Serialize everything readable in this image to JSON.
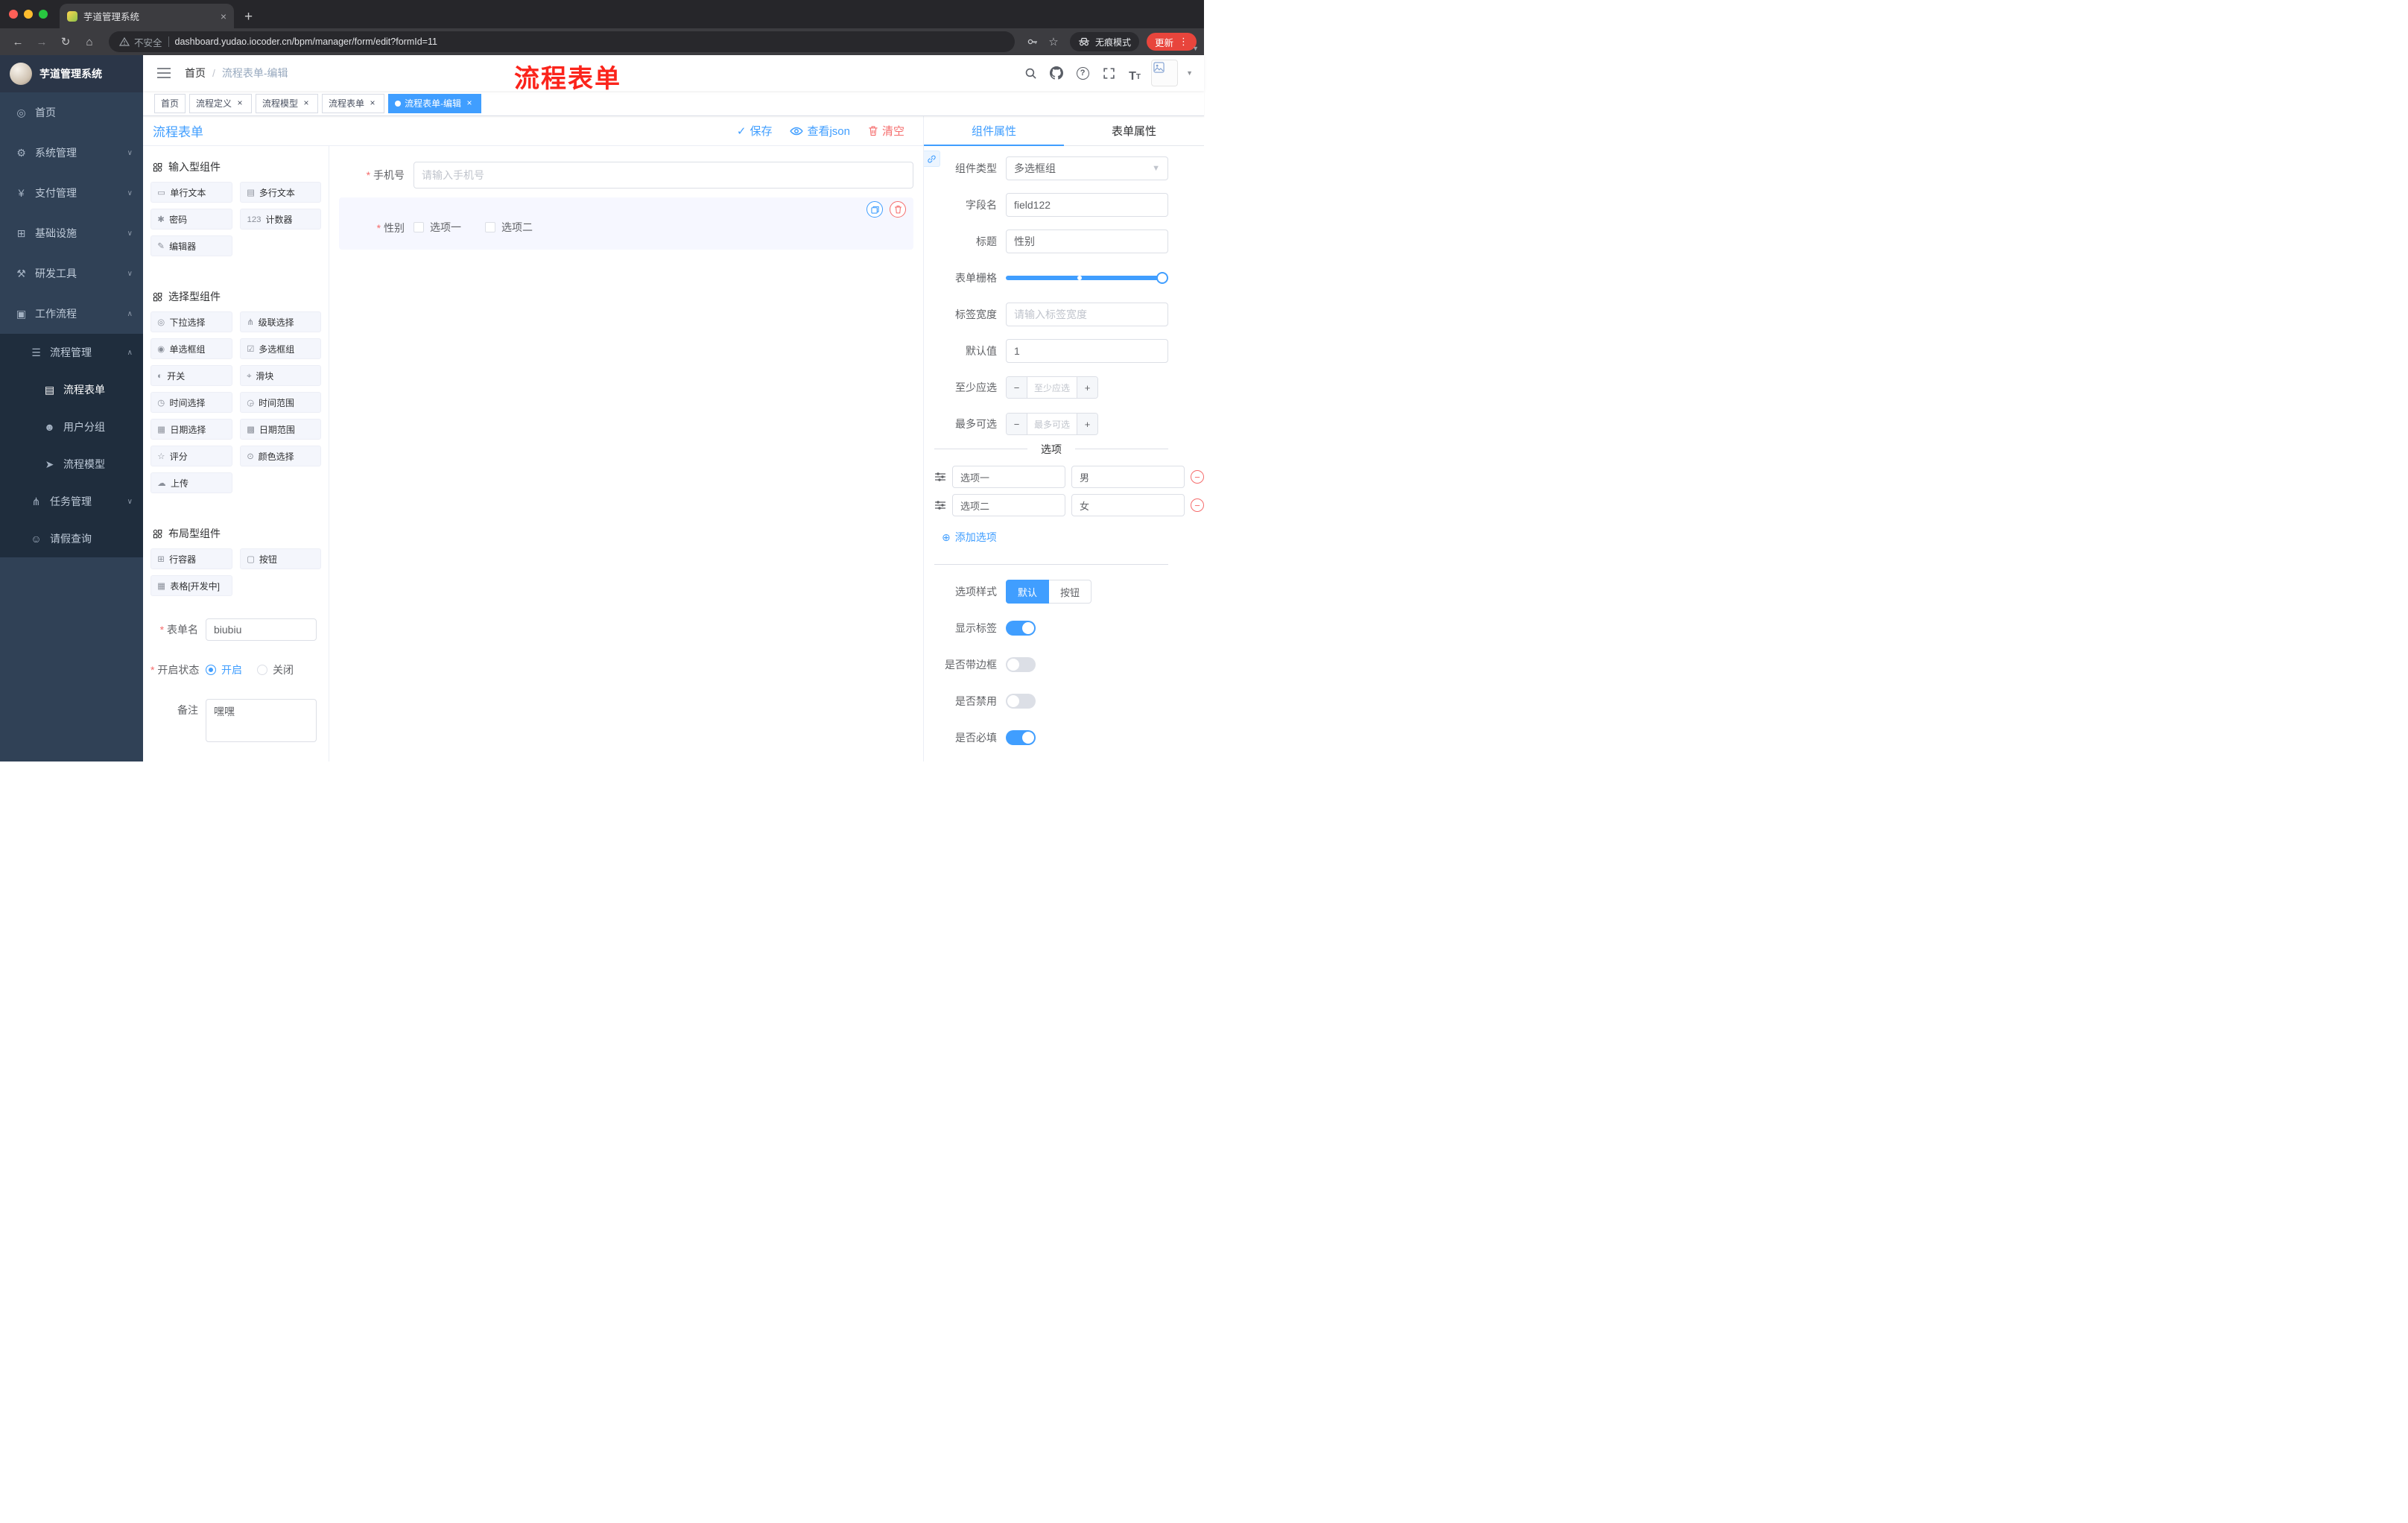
{
  "colors": {
    "accent": "#409eff",
    "danger": "#f56c6c",
    "sidebar_bg": "#304156",
    "submenu_bg": "#1f2d3d",
    "tag_active": "#409eff",
    "update_red": "#e8453c"
  },
  "browser": {
    "tab_title": "芋道管理系统",
    "security_label": "不安全",
    "url": "dashboard.yudao.iocoder.cn/bpm/manager/form/edit?formId=11",
    "incognito_label": "无痕模式",
    "update_label": "更新"
  },
  "annotation_title": "流程表单",
  "navbar": {
    "breadcrumb_home": "首页",
    "breadcrumb_sep": "/",
    "breadcrumb_current": "流程表单-编辑"
  },
  "tags": [
    {
      "label": "首页",
      "closable": false,
      "active": false
    },
    {
      "label": "流程定义",
      "closable": true,
      "active": false
    },
    {
      "label": "流程模型",
      "closable": true,
      "active": false
    },
    {
      "label": "流程表单",
      "closable": true,
      "active": false
    },
    {
      "label": "流程表单-编辑",
      "closable": true,
      "active": true
    }
  ],
  "sidebar": {
    "logo_title": "芋道管理系统",
    "menu": [
      {
        "id": "home",
        "label": "首页",
        "icon": "dashboard-icon",
        "glyph": "◎",
        "level": 1
      },
      {
        "id": "system-management",
        "label": "系统管理",
        "icon": "gear-icon",
        "glyph": "⚙",
        "level": 1,
        "chevron": "down"
      },
      {
        "id": "payment-management",
        "label": "支付管理",
        "icon": "yen-icon",
        "glyph": "¥",
        "level": 1,
        "chevron": "down"
      },
      {
        "id": "infrastructure",
        "label": "基础设施",
        "icon": "infrastructure-icon",
        "glyph": "⊞",
        "level": 1,
        "chevron": "down"
      },
      {
        "id": "dev-tools",
        "label": "研发工具",
        "icon": "tools-icon",
        "glyph": "⚒",
        "level": 1,
        "chevron": "down"
      },
      {
        "id": "workflow",
        "label": "工作流程",
        "icon": "workflow-icon",
        "glyph": "▣",
        "level": 1,
        "chevron": "up"
      },
      {
        "id": "process-management",
        "label": "流程管理",
        "icon": "process-list-icon",
        "glyph": "☰",
        "level": 2,
        "chevron": "up"
      },
      {
        "id": "process-form",
        "label": "流程表单",
        "icon": "form-document-icon",
        "glyph": "▤",
        "level": 3,
        "active": true
      },
      {
        "id": "user-group",
        "label": "用户分组",
        "icon": "user-group-icon",
        "glyph": "☻",
        "level": 3
      },
      {
        "id": "process-model",
        "label": "流程模型",
        "icon": "send-icon",
        "glyph": "➤",
        "level": 3
      },
      {
        "id": "task-management",
        "label": "任务管理",
        "icon": "task-tree-icon",
        "glyph": "⋔",
        "level": 2,
        "chevron": "down"
      },
      {
        "id": "leave-query",
        "label": "请假查询",
        "icon": "person-icon",
        "glyph": "☺",
        "level": 2
      }
    ]
  },
  "editor": {
    "title": "流程表单",
    "save_label": "保存",
    "view_json_label": "查看json",
    "clear_label": "清空",
    "palette_sections": [
      {
        "title": "输入型组件",
        "items": [
          {
            "label": "单行文本",
            "icon": "single-line-text-icon",
            "glyph": "▭"
          },
          {
            "label": "多行文本",
            "icon": "multiline-text-icon",
            "glyph": "▤"
          },
          {
            "label": "密码",
            "icon": "password-icon",
            "glyph": "✱"
          },
          {
            "label": "计数器",
            "icon": "counter-icon",
            "glyph": "123"
          },
          {
            "label": "编辑器",
            "icon": "editor-icon",
            "glyph": "✎"
          }
        ]
      },
      {
        "title": "选择型组件",
        "items": [
          {
            "label": "下拉选择",
            "icon": "select-icon",
            "glyph": "◎"
          },
          {
            "label": "级联选择",
            "icon": "cascader-icon",
            "glyph": "⋔"
          },
          {
            "label": "单选框组",
            "icon": "radio-group-icon",
            "glyph": "◉"
          },
          {
            "label": "多选框组",
            "icon": "checkbox-group-icon",
            "glyph": "☑"
          },
          {
            "label": "开关",
            "icon": "switch-icon",
            "glyph": "◐"
          },
          {
            "label": "滑块",
            "icon": "slider-icon",
            "glyph": "⌖"
          },
          {
            "label": "时间选择",
            "icon": "time-picker-icon",
            "glyph": "◷"
          },
          {
            "label": "时间范围",
            "icon": "time-range-icon",
            "glyph": "◶"
          },
          {
            "label": "日期选择",
            "icon": "date-picker-icon",
            "glyph": "▦"
          },
          {
            "label": "日期范围",
            "icon": "date-range-icon",
            "glyph": "▩"
          },
          {
            "label": "评分",
            "icon": "rate-icon",
            "glyph": "☆"
          },
          {
            "label": "颜色选择",
            "icon": "color-picker-icon",
            "glyph": "⊙"
          },
          {
            "label": "上传",
            "icon": "upload-icon",
            "glyph": "☁"
          }
        ]
      },
      {
        "title": "布局型组件",
        "items": [
          {
            "label": "行容器",
            "icon": "row-container-icon",
            "glyph": "⊞"
          },
          {
            "label": "按钮",
            "icon": "button-icon",
            "glyph": "▢"
          },
          {
            "label": "表格[开发中]",
            "icon": "table-icon",
            "glyph": "▦"
          }
        ]
      }
    ],
    "canvas": {
      "phone_label": "手机号",
      "phone_placeholder": "请输入手机号",
      "gender_label": "性别",
      "gender_options": [
        "选项一",
        "选项二"
      ]
    },
    "meta": {
      "form_name_label": "表单名",
      "form_name_value": "biubiu",
      "status_label": "开启状态",
      "status_on": "开启",
      "status_off": "关闭",
      "remark_label": "备注",
      "remark_value": "嘿嘿"
    }
  },
  "props": {
    "tab_component": "组件属性",
    "tab_form": "表单属性",
    "component_type_label": "组件类型",
    "component_type_value": "多选框组",
    "field_name_label": "字段名",
    "field_name_value": "field122",
    "title_label": "标题",
    "title_value": "性别",
    "grid_label": "表单栅格",
    "tag_width_label": "标签宽度",
    "tag_width_placeholder": "请输入标签宽度",
    "default_label": "默认值",
    "default_value": "1",
    "min_label": "至少应选",
    "min_placeholder": "至少应选",
    "max_label": "最多可选",
    "max_placeholder": "最多可选",
    "options_title": "选项",
    "options": [
      {
        "label": "选项一",
        "value": "男"
      },
      {
        "label": "选项二",
        "value": "女"
      }
    ],
    "add_option_label": "添加选项",
    "style_label": "选项样式",
    "style_default": "默认",
    "style_button": "按钮",
    "toggles": [
      {
        "label": "显示标签",
        "on": true
      },
      {
        "label": "是否带边框",
        "on": false
      },
      {
        "label": "是否禁用",
        "on": false
      },
      {
        "label": "是否必填",
        "on": true
      }
    ]
  }
}
